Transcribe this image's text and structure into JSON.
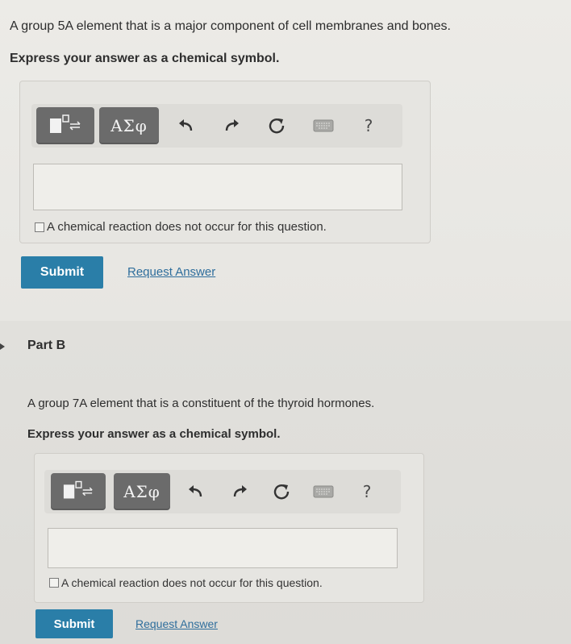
{
  "partA": {
    "question": "A group 5A element that is a major component of cell membranes and bones.",
    "instruction": "Express your answer as a chemical symbol.",
    "toolbar": {
      "greek_label": "ΑΣφ",
      "help_label": "?"
    },
    "input_value": "",
    "checkbox_label": "A chemical reaction does not occur for this question.",
    "submit_label": "Submit",
    "request_label": "Request Answer"
  },
  "partB": {
    "label": "Part B",
    "question": "A group 7A element that is a constituent of the thyroid hormones.",
    "instruction": "Express your answer as a chemical symbol.",
    "toolbar": {
      "greek_label": "ΑΣφ",
      "help_label": "?"
    },
    "input_value": "",
    "checkbox_label": "A chemical reaction does not occur for this question.",
    "submit_label": "Submit",
    "request_label": "Request Answer"
  },
  "icons": [
    "template-icon",
    "undo-icon",
    "redo-icon",
    "reset-icon",
    "keyboard-icon",
    "help-icon"
  ],
  "colors": {
    "submit_bg": "#2a7ea8",
    "link": "#2f6e9c",
    "tool_button": "#6b6b6b"
  }
}
